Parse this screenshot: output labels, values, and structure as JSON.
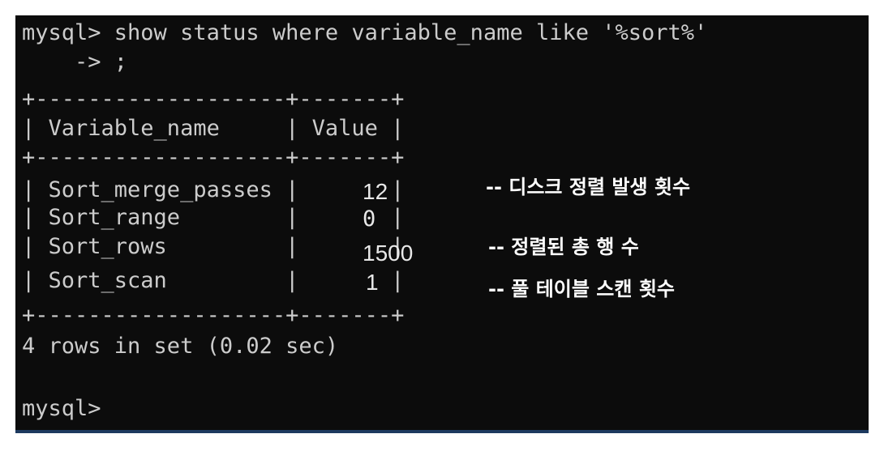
{
  "terminal": {
    "command_line": "mysql> show status where variable_name like '%sort%'",
    "continuation_line": "    -> ;",
    "border_top": "+-------------------+-------+",
    "header_row": "| Variable_name     | Value |",
    "border_mid": "+-------------------+-------+",
    "rows": [
      {
        "line": "| Sort_merge_passes |       |",
        "value": "12",
        "note": "-- 디스크 정렬 발생 횟수"
      },
      {
        "line": "| Sort_range        |       |",
        "value": "0",
        "note": ""
      },
      {
        "line": "| Sort_rows         |       |",
        "value": "1500",
        "note": "-- 정렬된 총 행 수"
      },
      {
        "line": "| Sort_scan         |       |",
        "value": "1",
        "note": "-- 풀 테이블 스캔 횟수"
      }
    ],
    "border_bottom": "+-------------------+-------+",
    "result_line": "4 rows in set (0.02 sec)",
    "prompt": "mysql>"
  }
}
